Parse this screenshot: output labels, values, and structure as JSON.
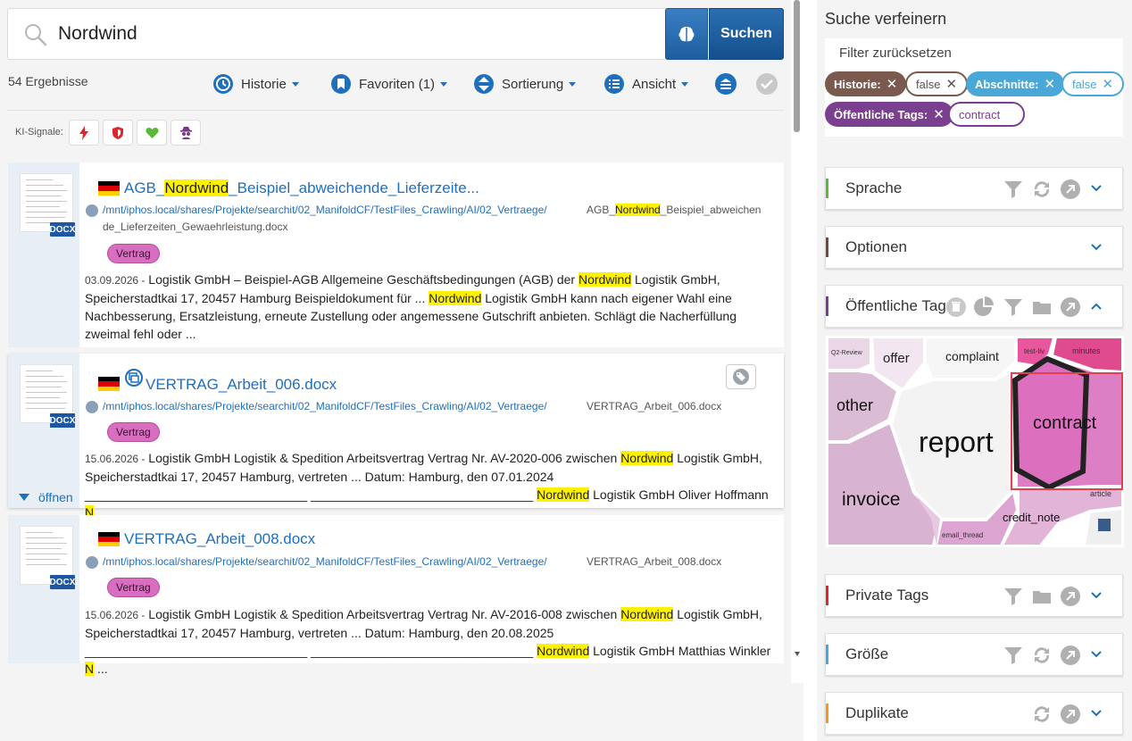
{
  "search": {
    "query": "Nordwind",
    "button_label": "Suchen"
  },
  "results_count": "54 Ergebnisse",
  "toolbar": {
    "history": "Historie",
    "favorites": "Favoriten (1)",
    "sort": "Sortierung",
    "view": "Ansicht"
  },
  "ki_label": "KI-Signale:",
  "results": [
    {
      "title_pre": "AGB_",
      "title_hl": "Nordwind",
      "title_post": "_Beispiel_abweichende_Lieferzeite...",
      "path": "/mnt/iphos.local/shares/Projekte/searchit/02_ManifoldCF/TestFiles_Crawling/AI/02_Vertraege/",
      "fname_pre": "AGB_",
      "fname_hl": "Nordwind",
      "fname_post": "_Beispiel_abweichen",
      "fname_line2": "de_Lieferzeiten_Gewaehrleistung.docx",
      "tag": "Vertrag",
      "date": "03.09.2026 -",
      "s1": " Logistik GmbH – Beispiel-AGB Allgemeine Geschäftsbedingungen (AGB) der ",
      "h1": "Nordwind",
      "s2": " Logistik GmbH, Speicherstadtkai 17, 20457 Hamburg Beispieldokument für ... ",
      "h2": "Nordwind",
      "s3": " Logistik GmbH kann nach eigener Wahl eine Nachbesserung, Ersatzleistung, erneute Zustellung oder angemessene Gutschrift anbieten. Schlägt die Nacherfüllung zweimal fehl oder ...",
      "doc_badge": "DOCX"
    },
    {
      "title": "VERTRAG_Arbeit_006.docx",
      "path": "/mnt/iphos.local/shares/Projekte/searchit/02_ManifoldCF/TestFiles_Crawling/AI/02_Vertraege/",
      "fname": "VERTRAG_Arbeit_006.docx",
      "tag": "Vertrag",
      "date": "15.06.2026 -",
      "s1": " Logistik GmbH Logistik & Spedition Arbeitsvertrag Vertrag Nr. AV-2020-006 zwischen ",
      "h1": "Nordwind",
      "s2": " Logistik GmbH, Speicherstadtkai 17, 20457 Hamburg, vertreten ... Datum: Hamburg, den 07.01.2024 ________________________________ ________________________________ ",
      "h2": "Nordwind",
      "s3": " Logistik GmbH Oliver Hoffmann ",
      "h3": "N",
      "s4": " ...",
      "open_label": "öffnen",
      "doc_badge": "DOCX"
    },
    {
      "title": "VERTRAG_Arbeit_008.docx",
      "path": "/mnt/iphos.local/shares/Projekte/searchit/02_ManifoldCF/TestFiles_Crawling/AI/02_Vertraege/",
      "fname": "VERTRAG_Arbeit_008.docx",
      "tag": "Vertrag",
      "date": "15.06.2026 -",
      "s1": " Logistik GmbH Logistik & Spedition Arbeitsvertrag Vertrag Nr. AV-2016-008 zwischen ",
      "h1": "Nordwind",
      "s2": " Logistik GmbH, Speicherstadtkai 17, 20457 Hamburg, vertreten ... Datum: Hamburg, den 20.08.2025 ________________________________ ________________________________ ",
      "h2": "Nordwind",
      "s3": " Logistik GmbH Matthias Winkler ",
      "h3": "N",
      "s4": " ...",
      "doc_badge": "DOCX"
    }
  ],
  "refine": {
    "title": "Suche verfeinern",
    "reset": "Filter zurücksetzen",
    "chips": {
      "historie": "Historie:",
      "historie_val": "false",
      "abschnitte": "Abschnitte:",
      "abschnitte_val": "false",
      "tags": "Öffentliche Tags:",
      "tags_val": "contract"
    },
    "panels": {
      "sprache": "Sprache",
      "optionen": "Optionen",
      "oeffentliche_tags": "Öffentliche Tags",
      "private_tags": "Private Tags",
      "groesse": "Größe",
      "duplikate": "Duplikate"
    },
    "cloud": {
      "q2": "Q2-Review",
      "offer": "offer",
      "complaint": "complaint",
      "testliv": "test-liv",
      "minutes": "minutes",
      "other": "other",
      "report": "report",
      "contract": "contract",
      "invoice": "invoice",
      "credit_note": "credit_note",
      "article": "article",
      "email_thread": "email_thread"
    }
  },
  "colors": {
    "accent": "#1f6fbf",
    "highlight": "#fff200",
    "tag_pink": "#d96dc0",
    "chip_brown": "#7a5a4f",
    "chip_blue": "#4aa8d8",
    "chip_purple": "#7b3f8f"
  }
}
